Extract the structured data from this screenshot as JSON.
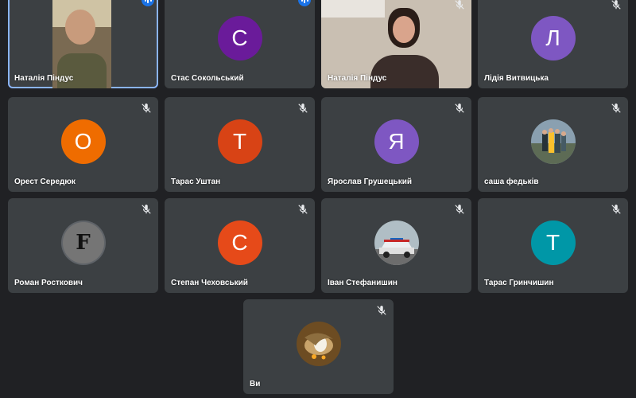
{
  "colors": {
    "background": "#202124",
    "tile": "#3c4043",
    "active_border": "#8ab4f8",
    "speaking": "#1a73e8"
  },
  "tiles": [
    {
      "name": "Наталія Піндус",
      "type": "video",
      "status": "speaking",
      "active": true
    },
    {
      "name": "Стас Сокольський",
      "type": "letter",
      "letter": "С",
      "color": "#6a1b9a",
      "status": "speaking"
    },
    {
      "name": "Наталія Піндус",
      "type": "video",
      "status": "muted"
    },
    {
      "name": "Лідія Витвицька",
      "type": "letter",
      "letter": "Л",
      "color": "#7e57c2",
      "status": "muted"
    },
    {
      "name": "Орест Середюк",
      "type": "letter",
      "letter": "О",
      "color": "#ef6c00",
      "status": "muted"
    },
    {
      "name": "Тарас Уштан",
      "type": "letter",
      "letter": "Т",
      "color": "#d84315",
      "status": "muted"
    },
    {
      "name": "Ярослав Грушецький",
      "type": "letter",
      "letter": "Я",
      "color": "#7e57c2",
      "status": "muted"
    },
    {
      "name": "саша федьків",
      "type": "photo",
      "photo": "group-photo",
      "status": "muted"
    },
    {
      "name": "Роман Росткович",
      "type": "photo",
      "photo": "letter-f-logo",
      "logo_text": "F",
      "status": "muted"
    },
    {
      "name": "Степан Чеховський",
      "type": "letter",
      "letter": "С",
      "color": "#e64a19",
      "status": "muted"
    },
    {
      "name": "Іван Стефанишин",
      "type": "photo",
      "photo": "car-photo",
      "status": "muted"
    },
    {
      "name": "Тарас Гринчишин",
      "type": "letter",
      "letter": "Т",
      "color": "#0097a7",
      "status": "muted"
    },
    {
      "name": "Ви",
      "type": "photo",
      "photo": "bird-photo",
      "status": "muted"
    }
  ]
}
